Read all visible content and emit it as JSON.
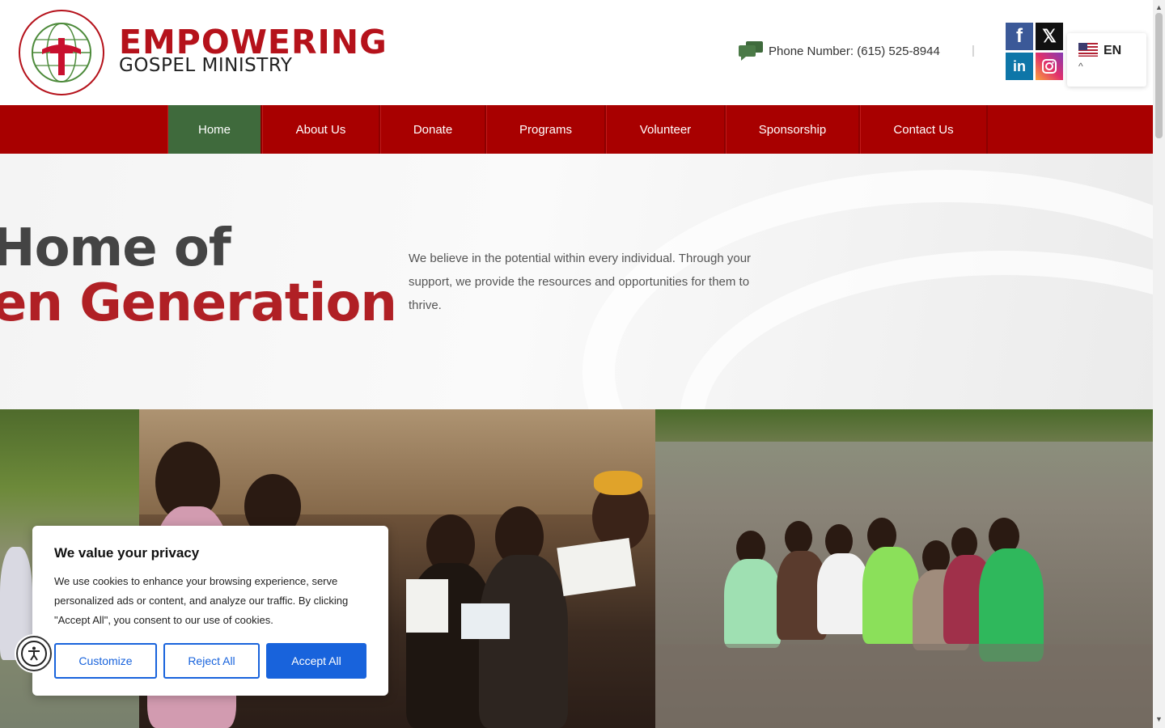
{
  "header": {
    "logo_main": "EMPOWERING",
    "logo_sub": "GOSPEL MINISTRY",
    "phone_label": "Phone Number: (615) 525-8944",
    "separator": "|",
    "social": [
      {
        "name": "facebook",
        "glyph": "f"
      },
      {
        "name": "x",
        "glyph": "𝕏"
      },
      {
        "name": "linkedin",
        "glyph": "in"
      },
      {
        "name": "instagram",
        "glyph": "◎"
      }
    ],
    "language": {
      "code": "EN",
      "caret": "^"
    }
  },
  "nav": {
    "items": [
      {
        "label": "Home",
        "active": true
      },
      {
        "label": "About Us"
      },
      {
        "label": "Donate"
      },
      {
        "label": "Programs"
      },
      {
        "label": "Volunteer"
      },
      {
        "label": "Sponsorship"
      },
      {
        "label": "Contact Us"
      }
    ]
  },
  "hero": {
    "line1": "Home of",
    "line2": "en Generation",
    "text": "We believe in the potential within every individual. Through your support, we provide the resources and opportunities for them to thrive."
  },
  "cookie": {
    "title": "We value your privacy",
    "body": "We use cookies to enhance your browsing experience, serve personalized ads or content, and analyze our traffic. By clicking \"Accept All\", you consent to our use of cookies.",
    "customize": "Customize",
    "reject": "Reject All",
    "accept": "Accept All"
  },
  "colors": {
    "brand_red": "#a80000",
    "nav_active": "#3f6a3c",
    "cookie_blue": "#1863dc"
  }
}
